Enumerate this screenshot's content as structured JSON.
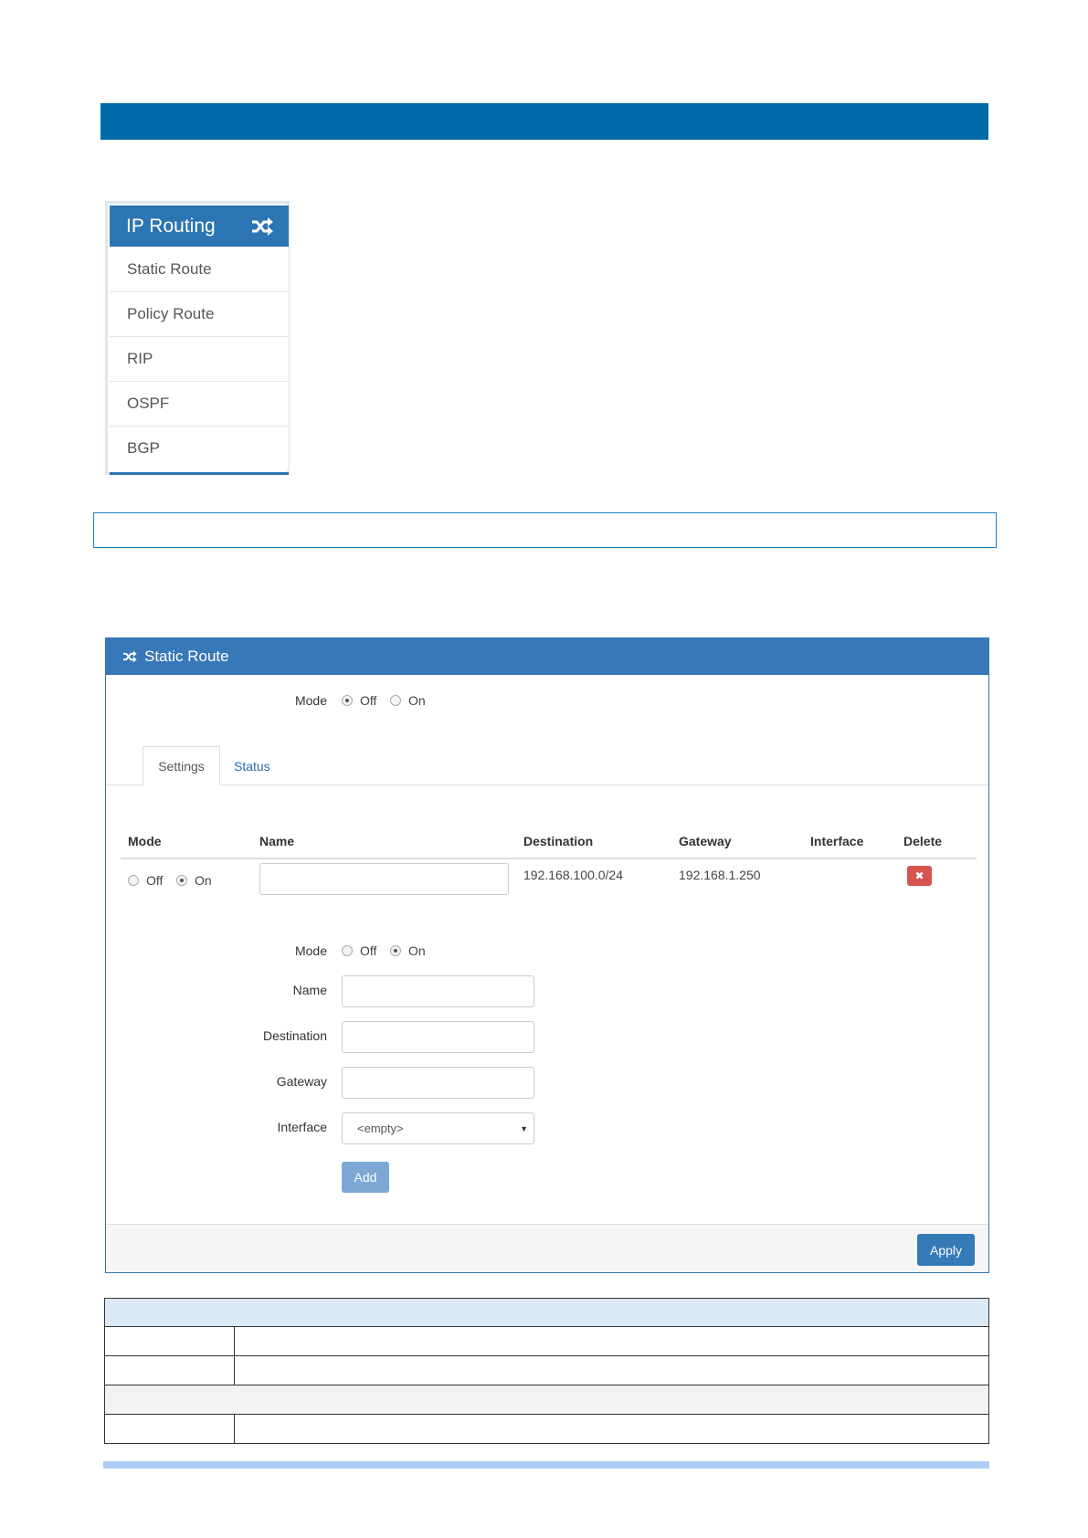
{
  "sidebar": {
    "title": "IP Routing",
    "icon": "shuffle-icon",
    "items": [
      {
        "label": "Static Route"
      },
      {
        "label": "Policy Route"
      },
      {
        "label": "RIP"
      },
      {
        "label": "OSPF"
      },
      {
        "label": "BGP"
      }
    ]
  },
  "panel": {
    "title": "Static Route",
    "icon": "shuffle-icon",
    "mode": {
      "label": "Mode",
      "off": "Off",
      "on": "On",
      "selected": "Off"
    },
    "tabs": [
      {
        "label": "Settings",
        "active": true
      },
      {
        "label": "Status",
        "active": false
      }
    ],
    "table": {
      "headers": [
        "Mode",
        "Name",
        "Destination",
        "Gateway",
        "Interface",
        "Delete"
      ],
      "rows": [
        {
          "mode_off": "Off",
          "mode_on": "On",
          "mode_selected": "On",
          "name": "",
          "destination": "192.168.100.0/24",
          "gateway": "192.168.1.250",
          "interface": "",
          "delete_icon": "close-icon"
        }
      ]
    },
    "form": {
      "mode_label": "Mode",
      "mode_off": "Off",
      "mode_on": "On",
      "mode_selected": "On",
      "name_label": "Name",
      "destination_label": "Destination",
      "gateway_label": "Gateway",
      "interface_label": "Interface",
      "interface_value": "<empty>",
      "add_label": "Add"
    },
    "apply_label": "Apply"
  },
  "colors": {
    "top_bar": "#006aa8",
    "panel_header": "#3778b8",
    "delete": "#d9534f",
    "apply": "#337ab7"
  }
}
